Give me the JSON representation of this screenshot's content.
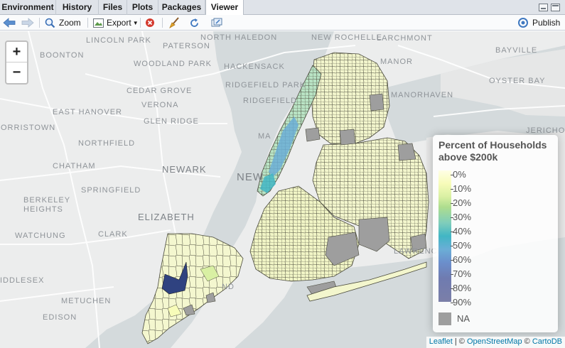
{
  "tabs": [
    {
      "label": "Environment"
    },
    {
      "label": "History"
    },
    {
      "label": "Files"
    },
    {
      "label": "Plots"
    },
    {
      "label": "Packages"
    },
    {
      "label": "Viewer"
    }
  ],
  "active_tab": "Viewer",
  "toolbar": {
    "zoom_label": "Zoom",
    "export_label": "Export",
    "publish_label": "Publish"
  },
  "map": {
    "zoom_in": "+",
    "zoom_out": "−",
    "places": [
      "LINCOLN PARK",
      "NORTH HALEDON",
      "NEW ROCHELLE",
      "LARCHMONT",
      "BOONTON",
      "PATERSON",
      "WOODLAND PARK",
      "HACKENSACK",
      "MANOR",
      "BAYVILLE",
      "CEDAR GROVE",
      "RIDGEFIELD PARK",
      "VERONA",
      "RIDGEFIELD",
      "OYSTER BAY",
      "EAST HANOVER",
      "MANORHAVEN",
      "GLEN RIDGE",
      "ORRISTOWN",
      "NORTHFIELD",
      "JERICHO",
      "CHATHAM",
      "NEWARK",
      "NEW",
      "SPRINGFIELD",
      "BERKELEY HEIGHTS",
      "ELIZABETH",
      "CLARK",
      "WATCHUNG",
      "LAWRENCE",
      "IDDLESEX",
      "ND",
      "METUCHEN",
      "EDISON",
      "MA"
    ],
    "highlight_color": "#2f4280",
    "na_color": "#9e9e9e"
  },
  "legend": {
    "title_line1": "Percent of Households",
    "title_line2": "above $200k",
    "ticks": [
      "0%",
      "10%",
      "20%",
      "30%",
      "40%",
      "50%",
      "60%",
      "70%",
      "80%",
      "90%"
    ],
    "na_label": "NA",
    "colors": [
      "#ffffe5",
      "#f7fcb9",
      "#d9f0a3",
      "#addd8e",
      "#7fcdbb",
      "#41b6c4",
      "#6baed6",
      "#6b8fcc",
      "#6f7bb0",
      "#7b7fa8"
    ]
  },
  "attribution": {
    "leaflet": "Leaflet",
    "sep1": " | © ",
    "osm": "OpenStreetMap",
    "sep2": " © ",
    "carto": "CartoDB"
  }
}
